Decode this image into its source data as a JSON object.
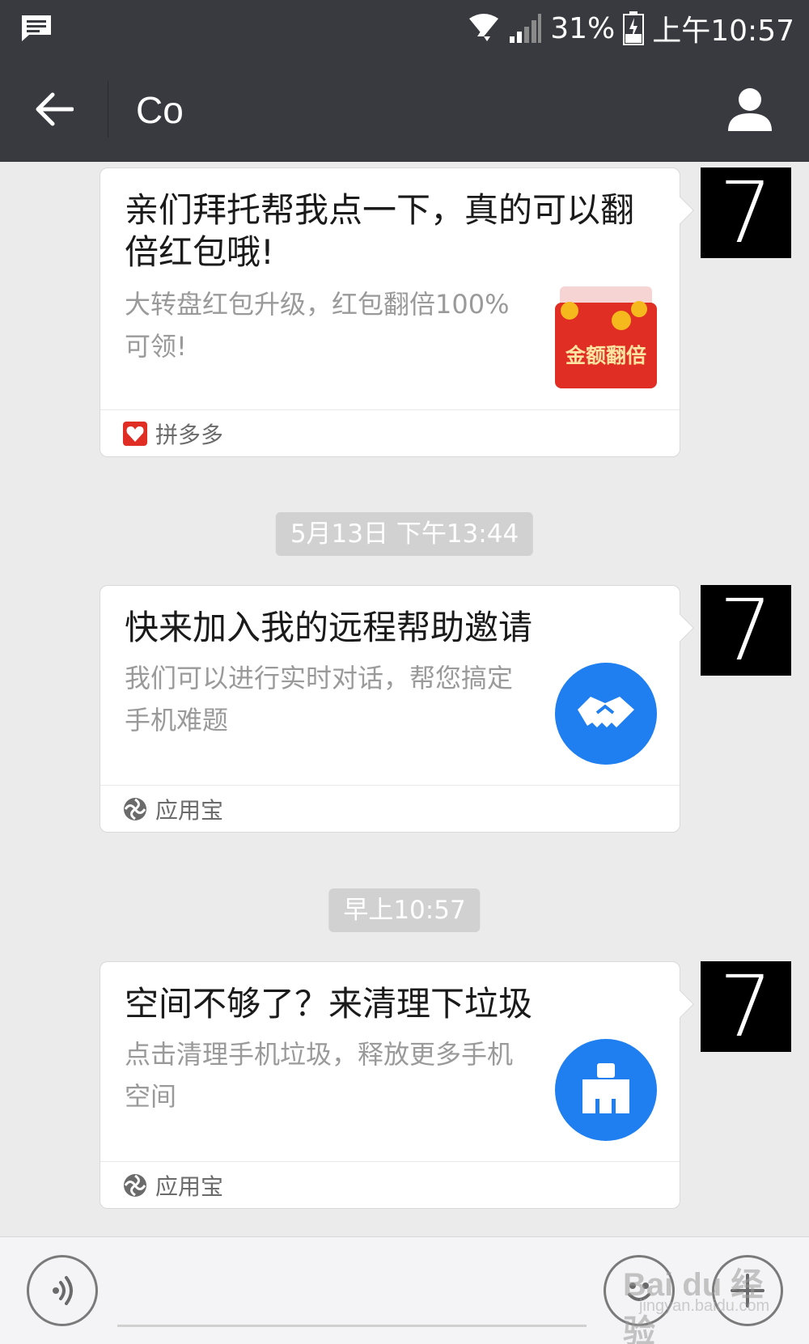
{
  "status_bar": {
    "battery_percent": "31%",
    "time": "上午10:57",
    "icons": [
      "message-icon",
      "wifi-icon",
      "signal-icon",
      "battery-icon"
    ]
  },
  "nav": {
    "title": "Co",
    "back_icon": "arrow-left-icon",
    "profile_icon": "person-icon"
  },
  "messages": [
    {
      "title": "亲们拜托帮我点一下，真的可以翻倍红包哦!",
      "description": "大转盘红包升级，红包翻倍100%可领!",
      "thumbnail_text": "金额翻倍",
      "source": "拼多多",
      "source_icon": "pinduoduo-icon",
      "avatar_text": "7"
    },
    {
      "timestamp": "5月13日 下午13:44",
      "title": "快来加入我的远程帮助邀请",
      "description": "我们可以进行实时对话，帮您搞定手机难题",
      "thumbnail_icon": "handshake-icon",
      "source": "应用宝",
      "source_icon": "yingyongbao-icon",
      "avatar_text": "7"
    },
    {
      "timestamp": "早上10:57",
      "title": "空间不够了？来清理下垃圾",
      "description": "点击清理手机垃圾，释放更多手机空间",
      "thumbnail_icon": "broom-icon",
      "source": "应用宝",
      "source_icon": "yingyongbao-icon",
      "avatar_text": "7"
    }
  ],
  "bottom_bar": {
    "voice_icon": "voice-icon",
    "emoji_icon": "emoji-icon",
    "plus_icon": "plus-icon"
  },
  "watermark": {
    "main": "Bai du 经验",
    "sub": "jingyan.baidu.com"
  },
  "colors": {
    "header_bg": "#393a3f",
    "chat_bg": "#ebebeb",
    "pdd_red": "#e02e24",
    "app_blue": "#1f7ff0",
    "timestamp_bg": "#d1d1d1"
  }
}
